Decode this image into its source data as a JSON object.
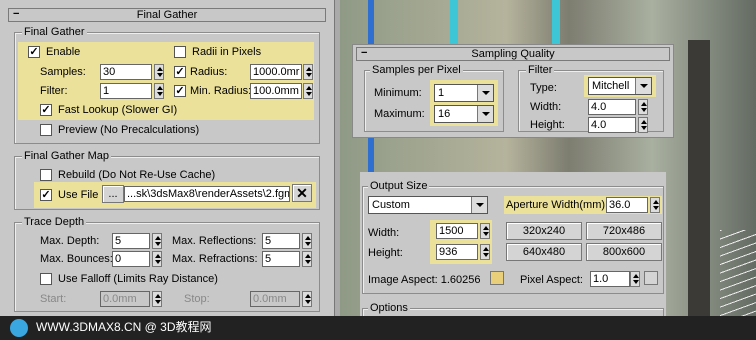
{
  "final_gather": {
    "title": "Final Gather",
    "group_title": "Final Gather",
    "enable_label": "Enable",
    "enable_checked": true,
    "radii_label": "Radii in Pixels",
    "radii_checked": false,
    "samples_label": "Samples:",
    "samples_value": "30",
    "radius_label": "Radius:",
    "radius_value": "1000.0mr",
    "radius_checked": true,
    "filter_label": "Filter:",
    "filter_value": "1",
    "min_radius_label": "Min. Radius:",
    "min_radius_value": "100.0mm",
    "min_radius_checked": true,
    "fast_lookup_label": "Fast Lookup (Slower GI)",
    "fast_lookup_checked": true,
    "preview_label": "Preview (No Precalculations)",
    "preview_checked": false
  },
  "fg_map": {
    "group_title": "Final Gather Map",
    "rebuild_label": "Rebuild (Do Not Re-Use Cache)",
    "rebuild_checked": false,
    "use_file_label": "Use File",
    "use_file_checked": true,
    "browse_label": "...",
    "file_path": "...sk\\3dsMax8\\renderAssets\\2.fgm",
    "clear_symbol": "✕"
  },
  "trace_depth": {
    "group_title": "Trace Depth",
    "max_depth_label": "Max. Depth:",
    "max_depth_value": "5",
    "max_reflections_label": "Max. Reflections:",
    "max_reflections_value": "5",
    "max_bounces_label": "Max. Bounces:",
    "max_bounces_value": "0",
    "max_refractions_label": "Max. Refractions:",
    "max_refractions_value": "5",
    "use_falloff_label": "Use Falloff (Limits Ray Distance)",
    "use_falloff_checked": false,
    "start_label": "Start:",
    "start_value": "0.0mm",
    "stop_label": "Stop:",
    "stop_value": "0.0mm"
  },
  "sampling_quality": {
    "title": "Sampling Quality",
    "spp_title": "Samples per Pixel",
    "minimum_label": "Minimum:",
    "minimum_value": "1",
    "maximum_label": "Maximum:",
    "maximum_value": "16",
    "filter_title": "Filter",
    "type_label": "Type:",
    "type_value": "Mitchell",
    "width_label": "Width:",
    "width_value": "4.0",
    "height_label": "Height:",
    "height_value": "4.0"
  },
  "output_size": {
    "group_title": "Output Size",
    "preset_value": "Custom",
    "aperture_label": "Aperture Width(mm):",
    "aperture_value": "36.0",
    "width_label": "Width:",
    "width_value": "1500",
    "height_label": "Height:",
    "height_value": "936",
    "presets": [
      "320x240",
      "720x486",
      "640x480",
      "800x600"
    ],
    "image_aspect_label": "Image Aspect: 1.60256",
    "pixel_aspect_label": "Pixel Aspect:",
    "pixel_aspect_value": "1.0"
  },
  "options": {
    "group_title": "Options"
  },
  "footer": {
    "watermark": "WWW.3DMAX8.CN @ 3D教程网"
  },
  "colors": {
    "highlight": "#ebe19a",
    "panel": "#c8c8c8"
  }
}
